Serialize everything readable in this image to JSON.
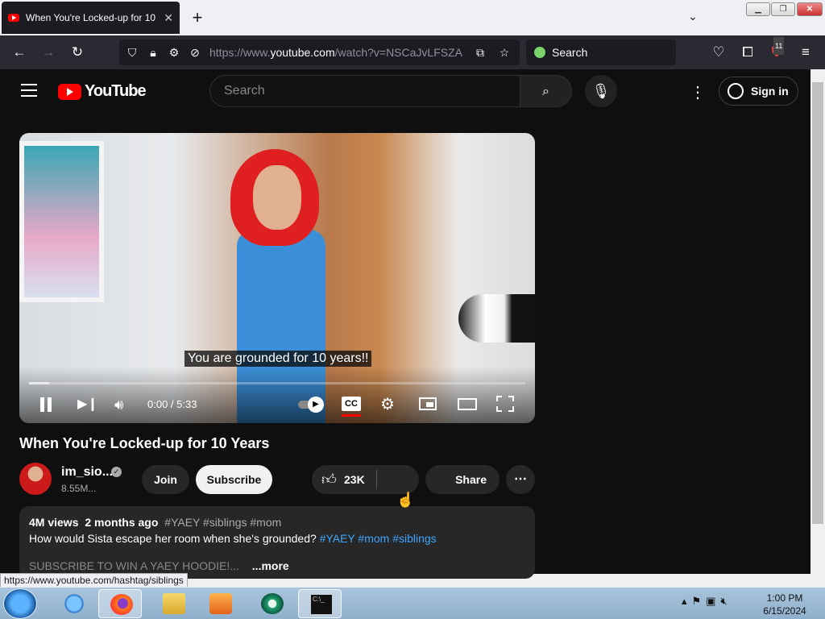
{
  "browser": {
    "tab_title": "When You're Locked-up for 10",
    "url_prefix": "https://www.",
    "url_domain": "youtube.com",
    "url_path": "/watch?v=NSCaJvLFSZA",
    "search_placeholder": "Search",
    "extensions_badge": "11",
    "status_url": "https://www.youtube.com/hashtag/siblings"
  },
  "youtube": {
    "logo_text": "YouTube",
    "search_placeholder": "Search",
    "sign_in": "Sign in"
  },
  "video": {
    "caption": "You are grounded for 10 years!!",
    "time": "0:00 / 5:33",
    "cc_label": "CC",
    "progress": 0.04,
    "title": "When You're Locked-up for 10 Years"
  },
  "channel": {
    "name": "im_sio...",
    "subscribers": "8.55M...",
    "join": "Join",
    "subscribe": "Subscribe"
  },
  "actions": {
    "likes": "23K",
    "share": "Share"
  },
  "description": {
    "views": "4M views",
    "age": "2 months ago",
    "tags": "#YAEY #siblings #mom",
    "text": "How would Sista escape her room when she's grounded?",
    "links": "#YAEY #mom #siblings",
    "line3": "SUBSCRIBE TO WIN A YAEY HOODIE!...",
    "more": "...more"
  },
  "taskbar": {
    "time": "1:00 PM",
    "date": "6/15/2024"
  }
}
